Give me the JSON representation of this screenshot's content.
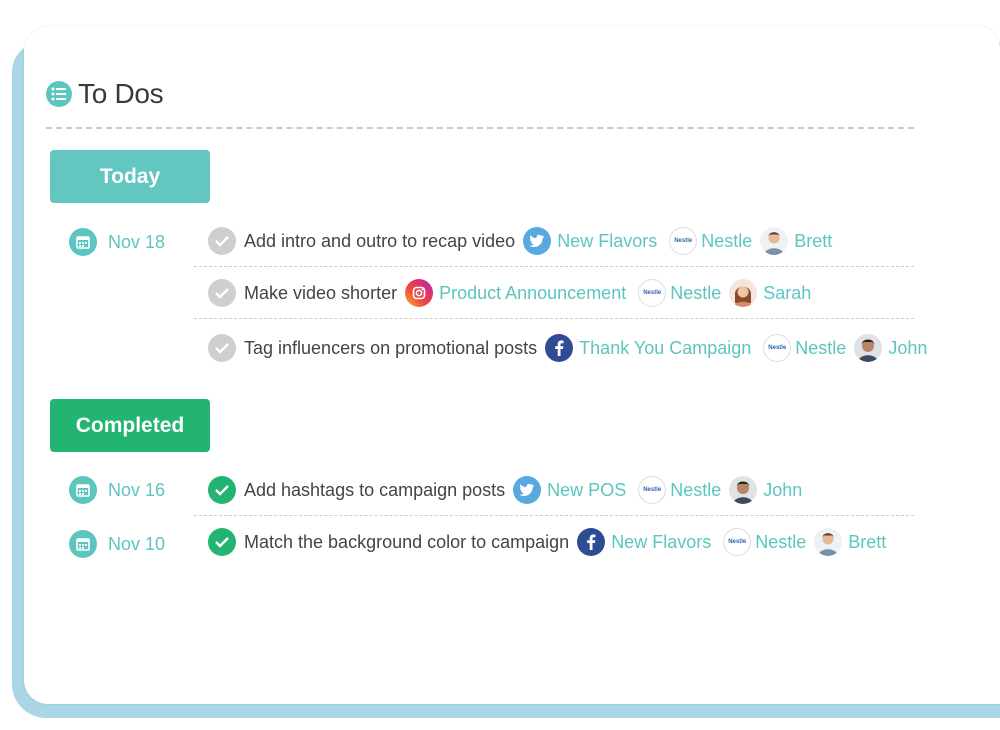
{
  "header": {
    "title": "To Dos"
  },
  "sections": {
    "today_label": "Today",
    "completed_label": "Completed"
  },
  "today": {
    "groups": [
      {
        "date": "Nov 18",
        "tasks": [
          {
            "text": "Add intro and outro to recap video",
            "network": "twitter",
            "campaign": "New Flavors",
            "brand": "Nestle",
            "person": "Brett",
            "done": false
          },
          {
            "text": "Make video shorter",
            "network": "instagram",
            "campaign": "Product Announcement",
            "brand": "Nestle",
            "person": "Sarah",
            "done": false
          },
          {
            "text": "Tag influencers on promotional posts",
            "network": "facebook",
            "campaign": "Thank You Campaign",
            "brand": "Nestle",
            "person": "John",
            "done": false
          }
        ]
      }
    ]
  },
  "completed": {
    "groups": [
      {
        "date": "Nov 16",
        "tasks": [
          {
            "text": "Add hashtags to campaign posts",
            "network": "twitter",
            "campaign": "New POS",
            "brand": "Nestle",
            "person": "John",
            "done": true
          }
        ]
      },
      {
        "date": "Nov 10",
        "tasks": [
          {
            "text": "Match the background color to campaign",
            "network": "facebook",
            "campaign": "New Flavors",
            "brand": "Nestle",
            "person": "Brett",
            "done": true
          }
        ]
      }
    ]
  },
  "brand_logo_text": "Nestle",
  "colors": {
    "accent": "#5cc5c0",
    "today": "#62c6c1",
    "completed": "#22b470",
    "frame": "#a9d7e6"
  },
  "icons": {
    "header": "list-icon",
    "date": "calendar-icon",
    "pending": "check-circle-pending-icon",
    "done": "check-circle-done-icon"
  }
}
